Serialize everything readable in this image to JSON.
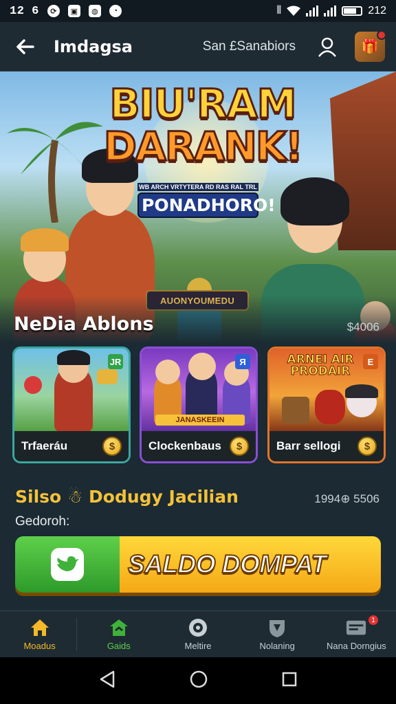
{
  "status_bar": {
    "time": "12 6",
    "right_text": "212"
  },
  "app_bar": {
    "title": "Imdagsa",
    "subtitle": "San £Sanabiors"
  },
  "hero": {
    "title_line1": "BIU'RAM",
    "title_line2": "DARANK!",
    "tag_small": "WB ARCH VRTYTERA RD RAS RAL TRL",
    "tag_big": "PONADHORO!",
    "badge": "AUONYOUMEDU"
  },
  "section": {
    "title": "NeDia Ablons",
    "meta": "$4006"
  },
  "cards": [
    {
      "label": "Trfaeráu",
      "border": "#3aa8a0",
      "corner": "JR",
      "corner_color": "#2fa24a"
    },
    {
      "label": "Clockenbaus",
      "border": "#8a4fd6",
      "corner": "Я",
      "corner_color": "#2f5fd8",
      "art_caption": "JANASKEEIN"
    },
    {
      "label": "Barr sellogi",
      "border": "#e0752a",
      "corner": "E",
      "corner_color": "#d45a1a",
      "art_caption": "ARNEI AIR PRODAIR"
    }
  ],
  "balance": {
    "title": "Silso ☃ Dodugy Jacilian",
    "meta": "1994⊕ 5506",
    "label": "Gedoroh:"
  },
  "cta": {
    "label": "SALDO DOMPAT"
  },
  "bottom_nav": [
    {
      "label": "Moadus",
      "icon": "home-icon",
      "active": true
    },
    {
      "label": "Gaids",
      "icon": "store-icon",
      "active": false
    },
    {
      "label": "Meltire",
      "icon": "target-icon",
      "active": false
    },
    {
      "label": "Nolaning",
      "icon": "shield-icon",
      "active": false
    },
    {
      "label": "Nana Dorngius",
      "icon": "wallet-icon",
      "active": false,
      "badge": "1"
    }
  ],
  "colors": {
    "accent": "#f5b829",
    "background": "#1b2a33",
    "cta_green": "#3fb23a",
    "cta_yellow": "#f8c224"
  }
}
